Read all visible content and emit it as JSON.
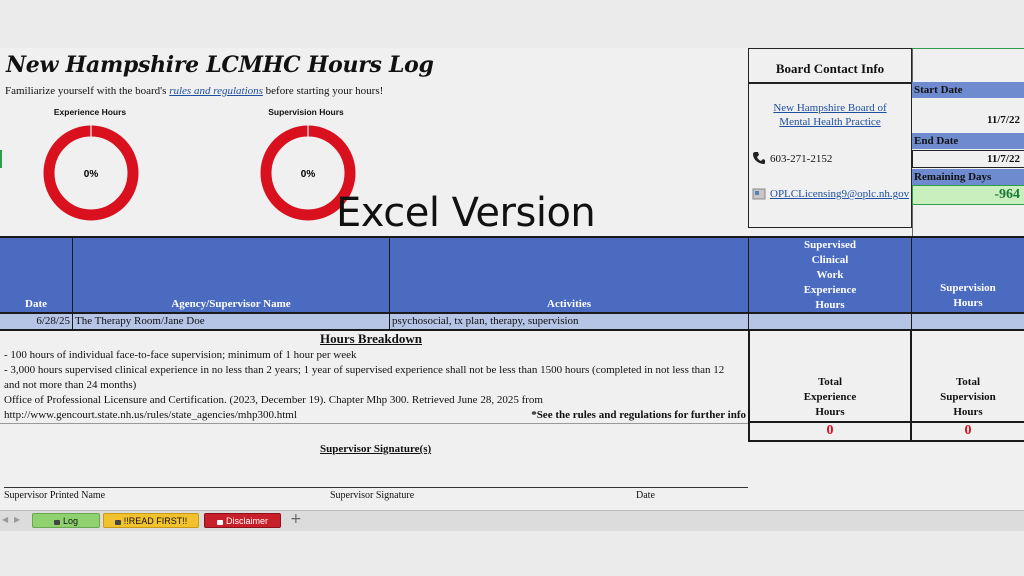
{
  "sheet": {
    "title": "New Hampshire LCMHC Hours Log",
    "intro_prefix": "Familiarize yourself with the board's ",
    "intro_link": "rules and regulations",
    "intro_suffix": " before starting your hours!",
    "experience_label": "Experience Hours",
    "experience_pct": "0%",
    "supervision_label": "Supervision Hours",
    "supervision_pct": "0%",
    "watermark": "Excel Version",
    "donut_color": "#d9101e"
  },
  "contact": {
    "heading": "Board Contact Info",
    "board_line1": "New Hampshire Board of",
    "board_line2": "Mental Health Practice",
    "phone": "603-271-2152",
    "email": "OPLCLicensing9@oplc.nh.gov"
  },
  "dates": {
    "start_label": "Start Date",
    "start_value": "11/7/22",
    "end_label": "End Date",
    "end_value": "11/7/22",
    "remaining_label": "Remaining Days",
    "remaining_value": "-964"
  },
  "table": {
    "headers": {
      "date": "Date",
      "agency": "Agency/Supervisor Name",
      "activities": "Activities",
      "exp_l1": "Supervised",
      "exp_l2": "Clinical",
      "exp_l3": "Work",
      "exp_l4": "Experience",
      "exp_l5": "Hours",
      "sup_l1": "Supervision",
      "sup_l2": "Hours"
    },
    "rows": [
      {
        "date": "6/28/25",
        "agency": "The Therapy Room/Jane Doe",
        "activities": "psychosocial, tx plan, therapy, supervision",
        "exp": "",
        "sup": ""
      }
    ]
  },
  "breakdown": {
    "heading": "Hours Breakdown",
    "line1": "- 100 hours of individual face-to-face supervision; minimum of 1 hour per week",
    "line2": "- 3,000 hours supervised clinical experience in no less than 2 years; 1 year of supervised experience shall not be less than 1500 hours (completed in not less than 12",
    "line3": "and not more than 24 months)",
    "line4": "Office of Professional Licensure and Certification. (2023, December 19). Chapter Mhp 300. Retrieved June 28, 2025 from",
    "line5": "http://www.gencourt.state.nh.us/rules/state_agencies/mhp300.html",
    "note": "*See the rules and regulations for further info"
  },
  "totals": {
    "exp_l1": "Total",
    "exp_l2": "Experience",
    "exp_l3": "Hours",
    "exp_value": "0",
    "sup_l1": "Total",
    "sup_l2": "Supervision",
    "sup_l3": "Hours",
    "sup_value": "0"
  },
  "signature": {
    "heading": "Supervisor Signature(s)",
    "printed_name": "Supervisor Printed Name",
    "signature": "Supervisor Signature",
    "date": "Date"
  },
  "tabs": [
    {
      "label": "Log",
      "color": "#8fd16e"
    },
    {
      "label": "!!READ FIRST!!",
      "color": "#f2c12e"
    },
    {
      "label": "Disclaimer",
      "color": "#c8202b"
    }
  ]
}
